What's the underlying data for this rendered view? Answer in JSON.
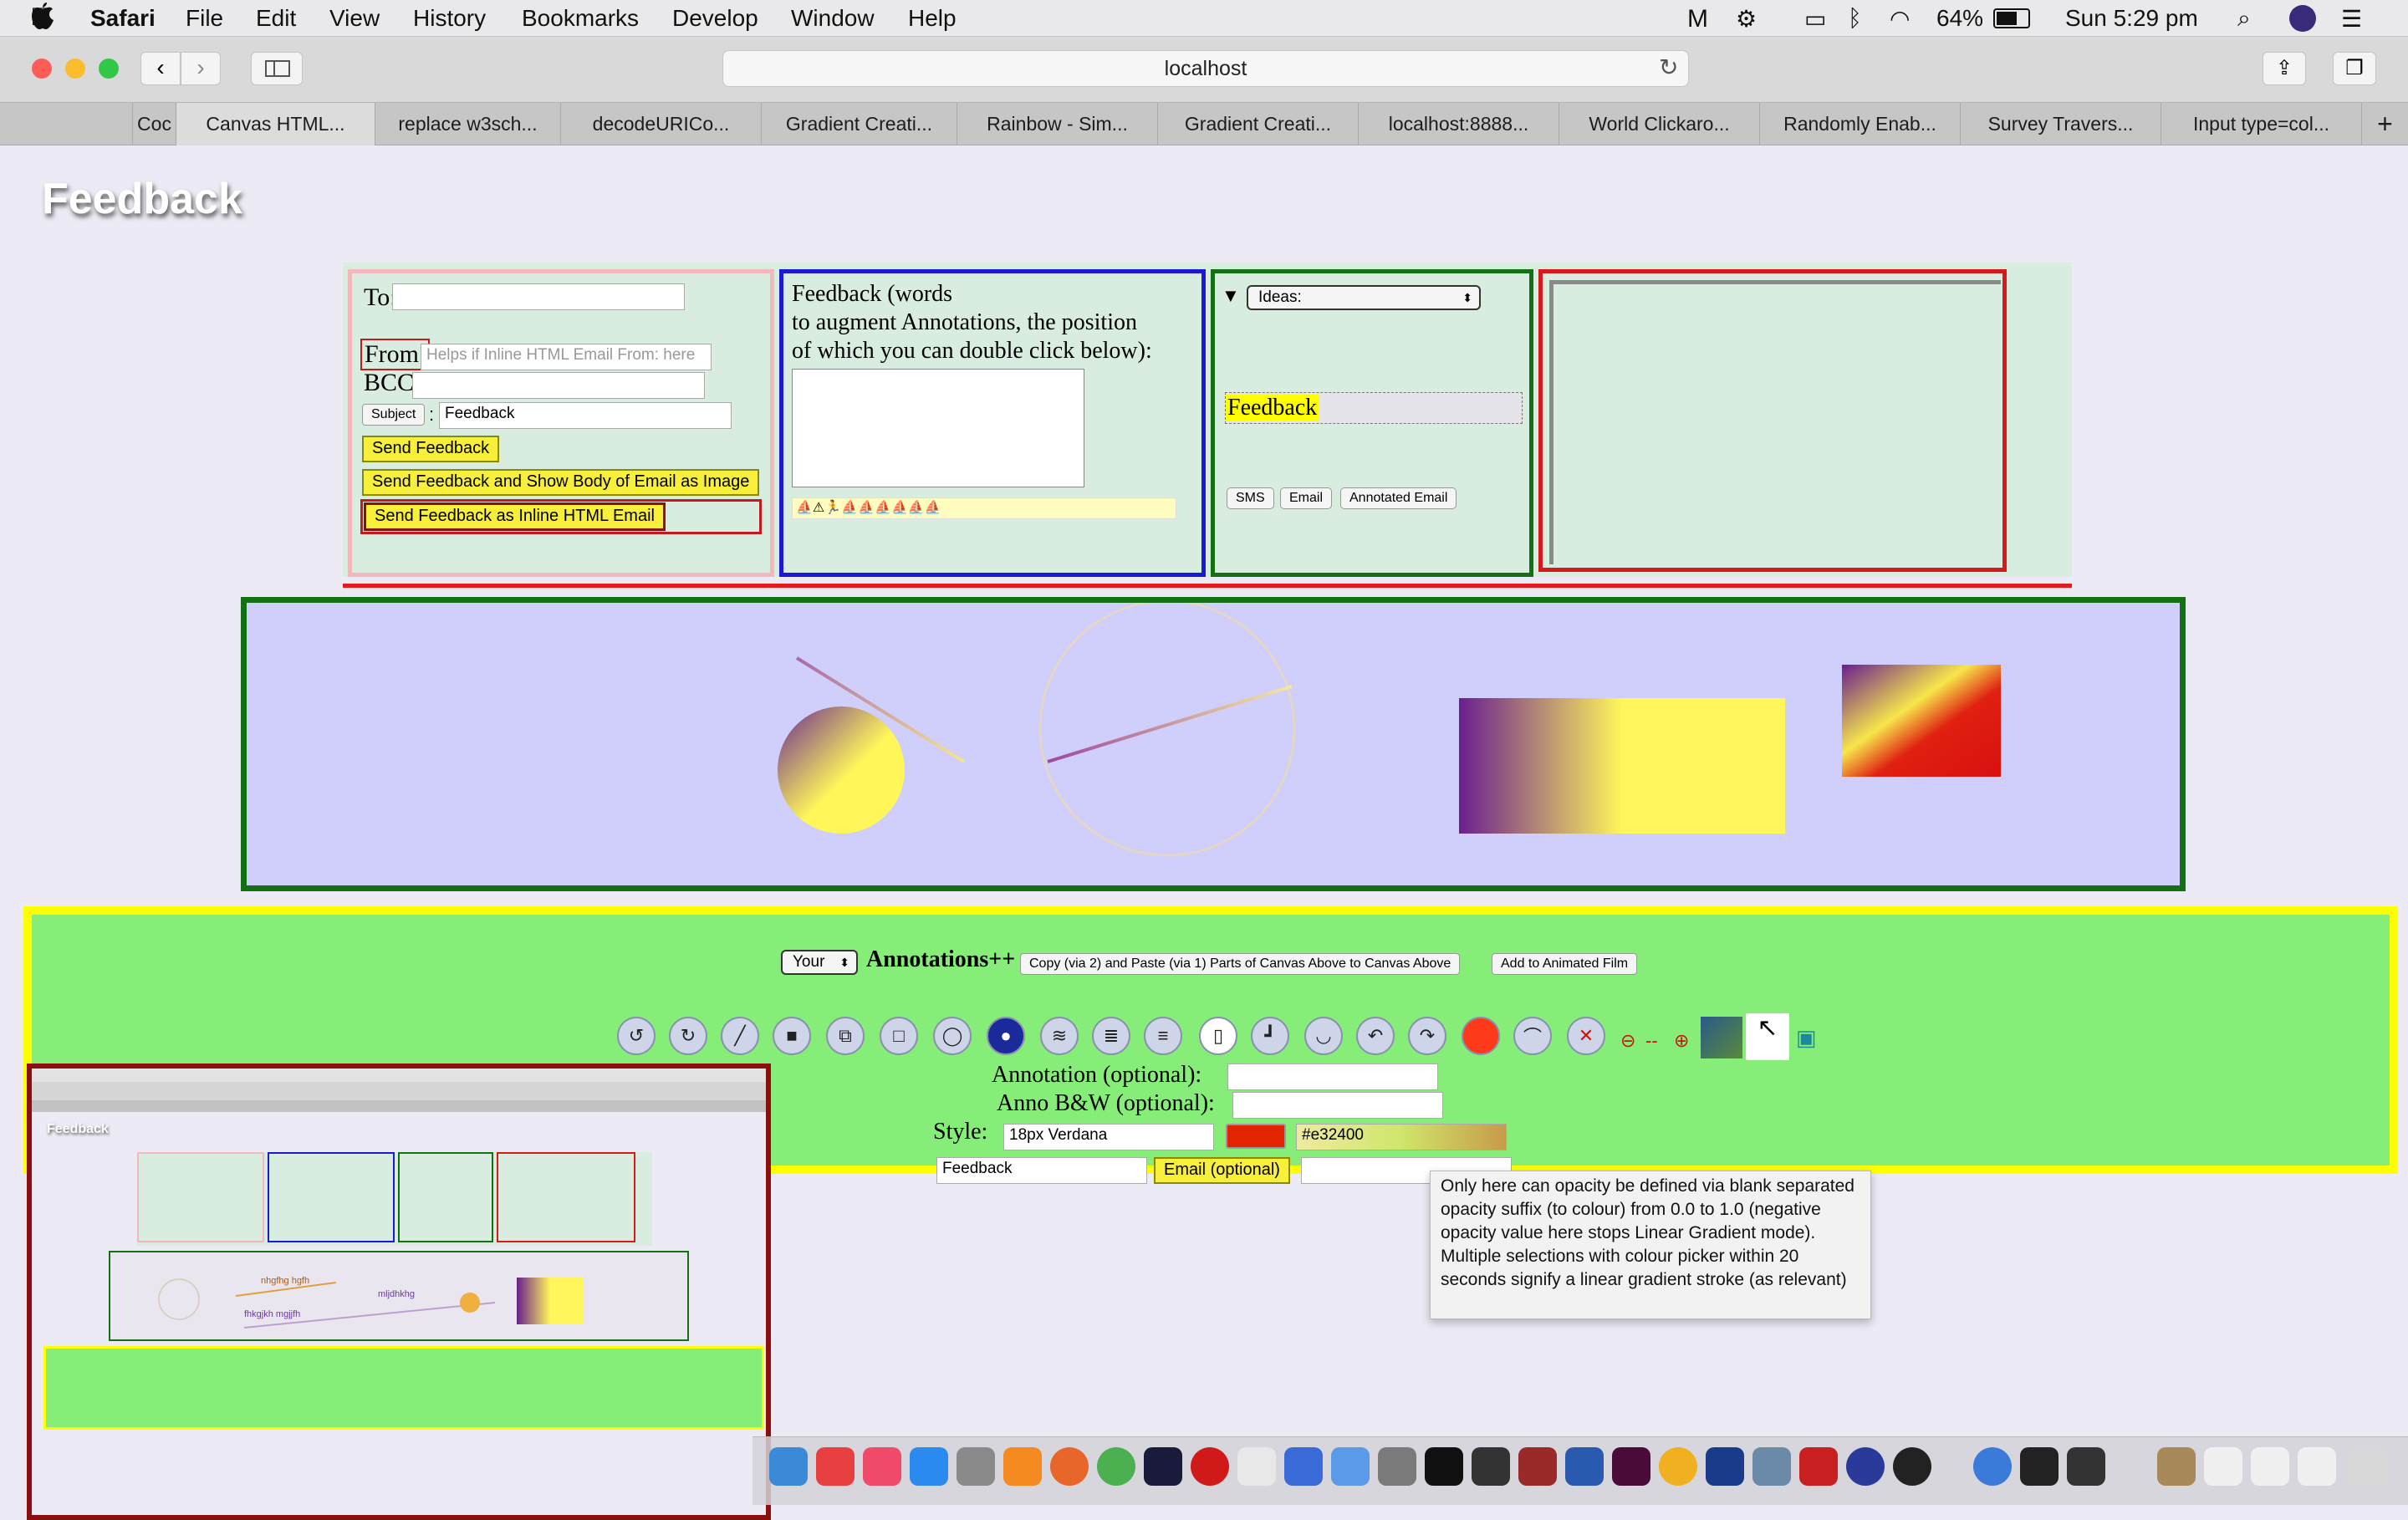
{
  "menubar": {
    "apple": "",
    "app": "Safari",
    "items": [
      "File",
      "Edit",
      "View",
      "History",
      "Bookmarks",
      "Develop",
      "Window",
      "Help"
    ],
    "battery": "64%",
    "clock": "Sun 5:29 pm"
  },
  "toolbar": {
    "url": "localhost"
  },
  "tabs": [
    "Coc",
    "Canvas HTML...",
    "replace w3sch...",
    "decodeURICo...",
    "Gradient Creati...",
    "Rainbow - Sim...",
    "Gradient Creati...",
    "localhost:8888...",
    "World Clickaro...",
    "Randomly Enab...",
    "Survey Travers...",
    "Input type=col..."
  ],
  "page": {
    "title": "Feedback",
    "email_panel": {
      "to_label": "To:",
      "to_value": "",
      "from_label": "From:",
      "from_placeholder": "Helps if Inline HTML Email From: here",
      "bcc_label": "BCC:",
      "subject_button": "Subject",
      "subject_colon": ":",
      "subject_value": "Feedback",
      "send_button": "Send Feedback",
      "send_image_button": "Send Feedback and Show Body of Email as Image",
      "send_inline_button": "Send Feedback as Inline HTML Email"
    },
    "feedback_panel": {
      "line1": "Feedback (words",
      "line2": "to augment Annotations, the position",
      "line3": "of which you can double click below):",
      "emoji_strip": "⛵⚠🏃⛵⛵⛵⛵⛵⛵"
    },
    "ideas_panel": {
      "select_value": "Ideas:",
      "feedback_tag": "Feedback",
      "sms_button": "SMS",
      "email_button": "Email",
      "annotated_email_button": "Annotated Email"
    },
    "annotations": {
      "your_select": "Your",
      "heading": "Annotations++",
      "copy_paste_button": "Copy (via 2) and Paste (via 1) Parts of Canvas Above to Canvas Above",
      "add_film_button": "Add to Animated Film",
      "annotation_label": "Annotation (optional):",
      "anno_bw_label": "Anno B&W (optional):",
      "style_label": "Style:",
      "style_value": "18px Verdana",
      "colour_value": "#e32400",
      "feedback_value": "Feedback",
      "email_button": "Email (optional)",
      "tooltip": "Only here can opacity be defined via blank separated opacity suffix (to colour) from 0.0 to 1.0  (negative opacity value here stops Linear Gradient mode). Multiple selections with colour picker within 20 seconds signify a linear gradient stroke (as relevant)"
    },
    "thumbnail": {
      "title": "Feedback",
      "scribble1": "nhgfhg hgfh",
      "scribble2": "mljdhkhg",
      "scribble3": "fhkgjkh mgjjfh"
    }
  },
  "colors": {
    "panel_bg": "#d8ecdf",
    "canvas_bg": "#d0cefa",
    "annotation_bg": "#86ee78",
    "yellow": "#ffff00",
    "accent_red": "#e32400"
  }
}
